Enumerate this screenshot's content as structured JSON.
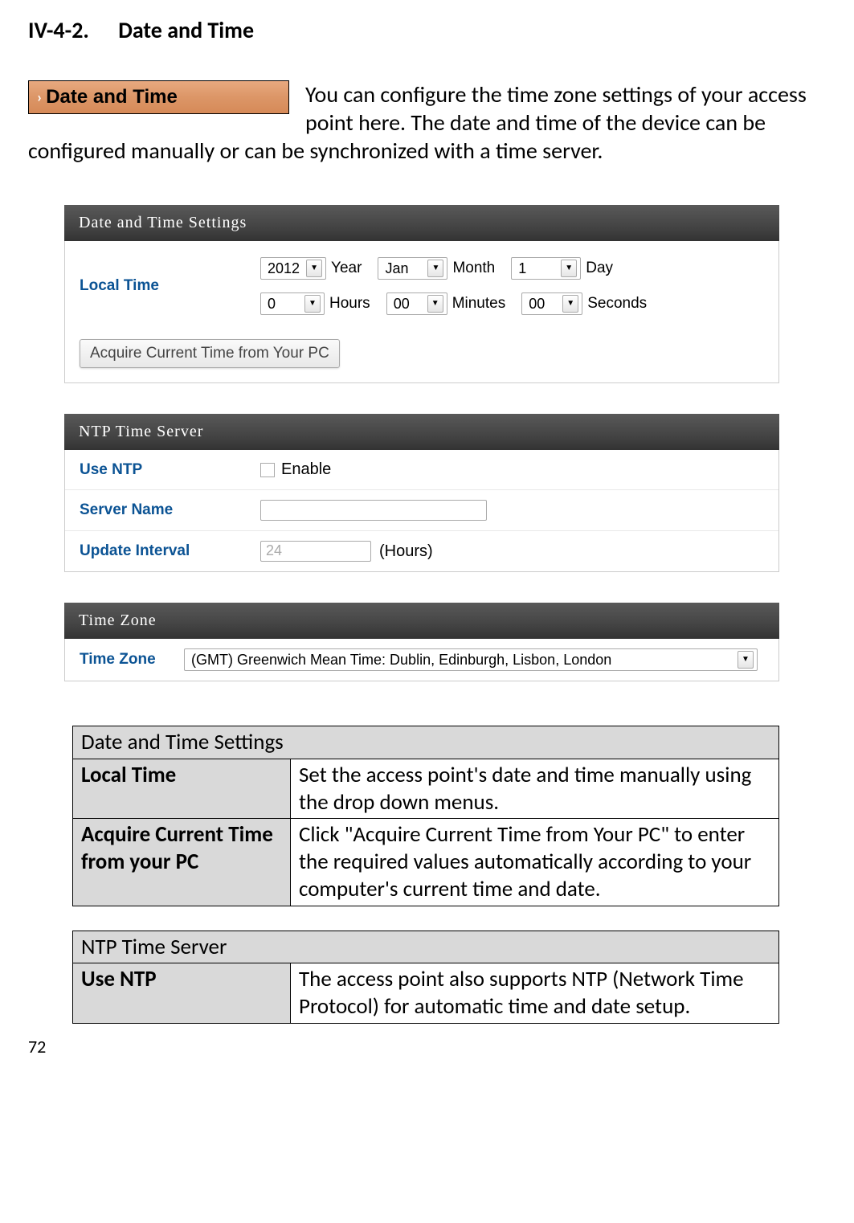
{
  "section": {
    "num": "IV-4-2.",
    "title": "Date and Time"
  },
  "tabBadge": {
    "chevron": "›",
    "label": "Date and Time"
  },
  "intro": "You can configure the time zone settings of your access point here. The date and time of the device can be configured manually or can be synchronized with a time server.",
  "panel1": {
    "title": "Date and Time Settings",
    "localTimeLabel": "Local Time",
    "year": "2012",
    "yearLabel": "Year",
    "month": "Jan",
    "monthLabel": "Month",
    "day": "1",
    "dayLabel": "Day",
    "hours": "0",
    "hoursLabel": "Hours",
    "minutes": "00",
    "minutesLabel": "Minutes",
    "seconds": "00",
    "secondsLabel": "Seconds",
    "button": "Acquire Current Time from Your PC"
  },
  "panel2": {
    "title": "NTP Time Server",
    "useNtpLabel": "Use NTP",
    "enableLabel": "Enable",
    "serverNameLabel": "Server Name",
    "updateIntervalLabel": "Update Interval",
    "intervalValue": "24",
    "intervalUnit": "(Hours)"
  },
  "panel3": {
    "title": "Time Zone",
    "tzLabel": "Time Zone",
    "tzValue": "(GMT) Greenwich Mean Time: Dublin, Edinburgh, Lisbon, London"
  },
  "desc1": {
    "header": "Date and Time Settings",
    "r1k": "Local Time",
    "r1v": "Set the access point's date and time manually using the drop down menus.",
    "r2k": "Acquire Current Time from your PC",
    "r2v": "Click \"Acquire Current Time from Your PC\" to enter the required values automatically according to your computer's current time and date."
  },
  "desc2": {
    "header": "NTP Time Server",
    "r1k": "Use NTP",
    "r1v": "The access point also supports NTP (Network Time Protocol) for automatic time and date setup."
  },
  "pageNum": "72"
}
